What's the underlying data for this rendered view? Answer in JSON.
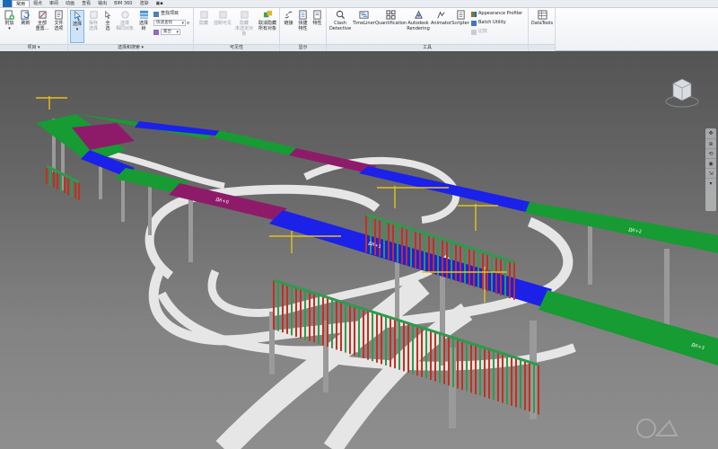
{
  "tabs": [
    {
      "label": "常用",
      "active": true
    },
    {
      "label": "视点",
      "active": false
    },
    {
      "label": "审阅",
      "active": false
    },
    {
      "label": "动画",
      "active": false
    },
    {
      "label": "查看",
      "active": false
    },
    {
      "label": "输出",
      "active": false
    },
    {
      "label": "BIM 360",
      "active": false
    },
    {
      "label": "渲染",
      "active": false
    },
    {
      "label": "▣▪",
      "active": false
    }
  ],
  "groups": {
    "project": {
      "title": "项目 ▾",
      "buttons": [
        {
          "label": "附加",
          "sub": "▾"
        },
        {
          "label": "刷新",
          "sub": ""
        },
        {
          "label": "全部",
          "sub": "重置..."
        },
        {
          "label": "文件",
          "sub": "选项"
        }
      ]
    },
    "select": {
      "title": "选择和搜索 ▾",
      "buttons": [
        {
          "label": "选择",
          "sub": "▾"
        },
        {
          "label": "保存",
          "sub": "选择"
        },
        {
          "label": "全",
          "sub": "选"
        },
        {
          "label": "选择",
          "sub": "相同对象"
        },
        {
          "label": "选择",
          "sub": "树"
        }
      ],
      "find_items": "查找项目",
      "quick_find_placeholder": "快速查找",
      "sets_dropdown": "集合"
    },
    "visibility": {
      "title": "可见性",
      "buttons": [
        {
          "label": "隐藏"
        },
        {
          "label": "强制可见"
        },
        {
          "label": "隐藏",
          "sub": "未选定对象"
        },
        {
          "label": "取消隐藏",
          "sub": "所有对象"
        }
      ]
    },
    "display": {
      "title": "显示",
      "buttons": [
        {
          "label": "链接"
        },
        {
          "label": "快捷",
          "sub": "特性"
        },
        {
          "label": "特性"
        }
      ]
    },
    "tools": {
      "title": "工具",
      "buttons": [
        {
          "label": "Clash",
          "sub": "Detective"
        },
        {
          "label": "TimeLiner",
          "sub": ""
        },
        {
          "label": "Quantification",
          "sub": ""
        },
        {
          "label": "Autodesk",
          "sub": "Rendering"
        },
        {
          "label": "Animator",
          "sub": ""
        },
        {
          "label": "Scripter",
          "sub": ""
        }
      ],
      "side_items": [
        "Appearance Profiler",
        "Batch Utility",
        "比较"
      ]
    },
    "datatools": {
      "title": "",
      "buttons": [
        {
          "label": "DataTools"
        }
      ]
    }
  },
  "icons": {
    "viewcube": "viewcube-icon",
    "nav_pan": "pan-icon",
    "nav_zoom": "zoom-icon",
    "nav_orbit": "orbit-icon",
    "nav_look": "look-icon",
    "nav_walk": "walk-icon"
  },
  "nav_glyphs": [
    "✥",
    "⊕",
    "⟲",
    "◉",
    "⇲",
    "▾"
  ],
  "scene": {
    "deck_labels": [
      "ДК+0",
      "ДК+1",
      "ДК+2",
      "ДК+3"
    ],
    "colors": {
      "green": "#179b33",
      "blue": "#1b21e8",
      "purple": "#8e1b6a",
      "deck_white": "#ececec",
      "scaffold_red": "#c2311f",
      "scaffold_green": "#2f9a4d",
      "crane_yellow": "#e3c21c"
    }
  }
}
